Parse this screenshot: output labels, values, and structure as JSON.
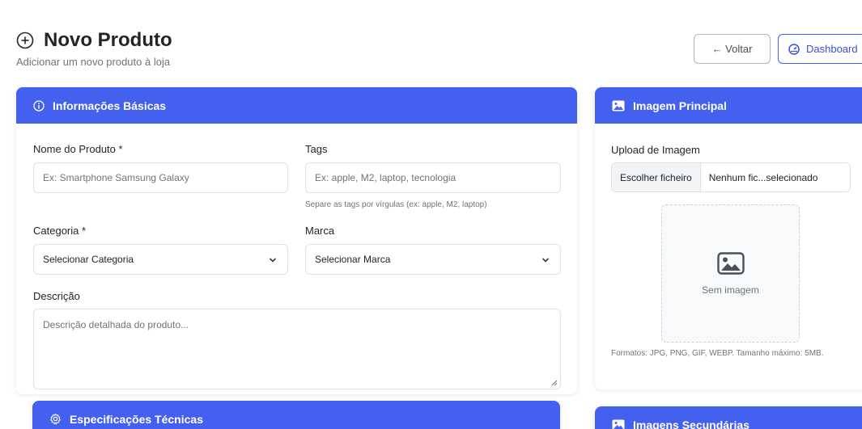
{
  "header": {
    "title": "Novo Produto",
    "subtitle": "Adicionar um novo produto à loja",
    "back_label": "← Voltar",
    "dashboard_label": "Dashboard"
  },
  "basic_info": {
    "title": "Informações Básicas",
    "name_label": "Nome do Produto *",
    "name_placeholder": "Ex: Smartphone Samsung Galaxy",
    "tags_label": "Tags",
    "tags_placeholder": "Ex: apple, M2, laptop, tecnologia",
    "tags_help": "Separe as tags por vírgulas (ex: apple, M2, laptop)",
    "category_label": "Categoria *",
    "category_value": "Selecionar Categoria",
    "brand_label": "Marca",
    "brand_value": "Selecionar Marca",
    "description_label": "Descrição",
    "description_placeholder": "Descrição detalhada do produto..."
  },
  "specs": {
    "title": "Especificações Técnicas"
  },
  "main_image": {
    "title": "Imagem Principal",
    "upload_label": "Upload de Imagem",
    "file_button": "Escolher ficheiro",
    "file_status": "Nenhum fic...selecionado",
    "no_image": "Sem imagem",
    "formats": "Formatos: JPG, PNG, GIF, WEBP. Tamanho máximo: 5MB."
  },
  "secondary_images": {
    "title": "Imagens Secundárias"
  },
  "colors": {
    "accent": "#4361ee",
    "border": "#dee2e6",
    "muted": "#6c757d"
  },
  "icons": [
    "plus-circle-icon",
    "info-icon",
    "gear-icon",
    "image-icon",
    "dashboard-icon",
    "chevron-down-icon"
  ]
}
